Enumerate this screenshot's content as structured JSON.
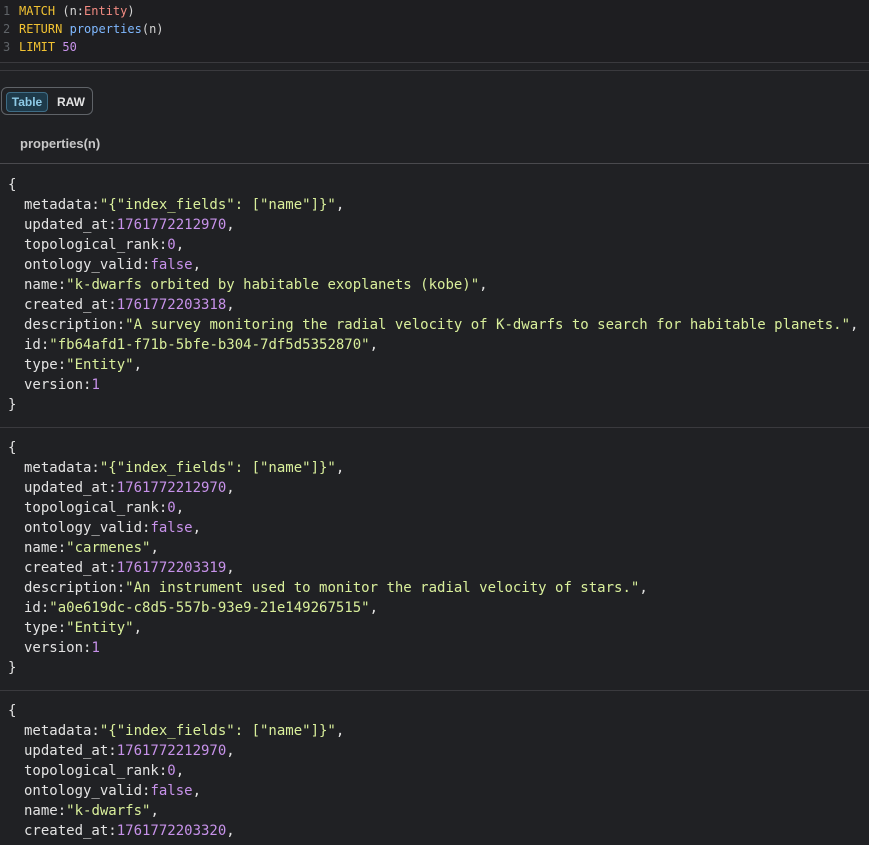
{
  "query": {
    "line_numbers": [
      "1",
      "2",
      "3"
    ],
    "line1": {
      "keyword": "MATCH",
      "open": " (n:",
      "label": "Entity",
      "close": ")"
    },
    "line2": {
      "keyword": "RETURN",
      "func": "properties",
      "args": "(n)"
    },
    "line3": {
      "keyword": "LIMIT",
      "value": "50"
    }
  },
  "tabs": {
    "table_label": "Table",
    "raw_label": "RAW",
    "active": "Table"
  },
  "column_header": "properties(n)",
  "records": [
    {
      "open": "{",
      "close": "}",
      "metadata": "\"{\"index_fields\": [\"name\"]}\"",
      "updated_at": "1761772212970",
      "topological_rank": "0",
      "ontology_valid": "false",
      "name": "\"k-dwarfs orbited by habitable exoplanets (kobe)\"",
      "created_at": "1761772203318",
      "description": "\"A survey monitoring the radial velocity of K-dwarfs to search for habitable planets.\"",
      "id": "\"fb64afd1-f71b-5bfe-b304-7df5d5352870\"",
      "type": "\"Entity\"",
      "version": "1"
    },
    {
      "open": "{",
      "close": "}",
      "metadata": "\"{\"index_fields\": [\"name\"]}\"",
      "updated_at": "1761772212970",
      "topological_rank": "0",
      "ontology_valid": "false",
      "name": "\"carmenes\"",
      "created_at": "1761772203319",
      "description": "\"An instrument used to monitor the radial velocity of stars.\"",
      "id": "\"a0e619dc-c8d5-557b-93e9-21e149267515\"",
      "type": "\"Entity\"",
      "version": "1"
    },
    {
      "open": "{",
      "metadata": "\"{\"index_fields\": [\"name\"]}\"",
      "updated_at": "1761772212970",
      "topological_rank": "0",
      "ontology_valid": "false",
      "name": "\"k-dwarfs\"",
      "created_at": "1761772203320"
    }
  ],
  "keys": {
    "metadata": "metadata:",
    "updated_at": "updated_at:",
    "topological_rank": "topological_rank:",
    "ontology_valid": "ontology_valid:",
    "name": "name:",
    "created_at": "created_at:",
    "description": "description:",
    "id": "id:",
    "type": "type:",
    "version": "version:"
  },
  "punct": {
    "comma": ","
  }
}
